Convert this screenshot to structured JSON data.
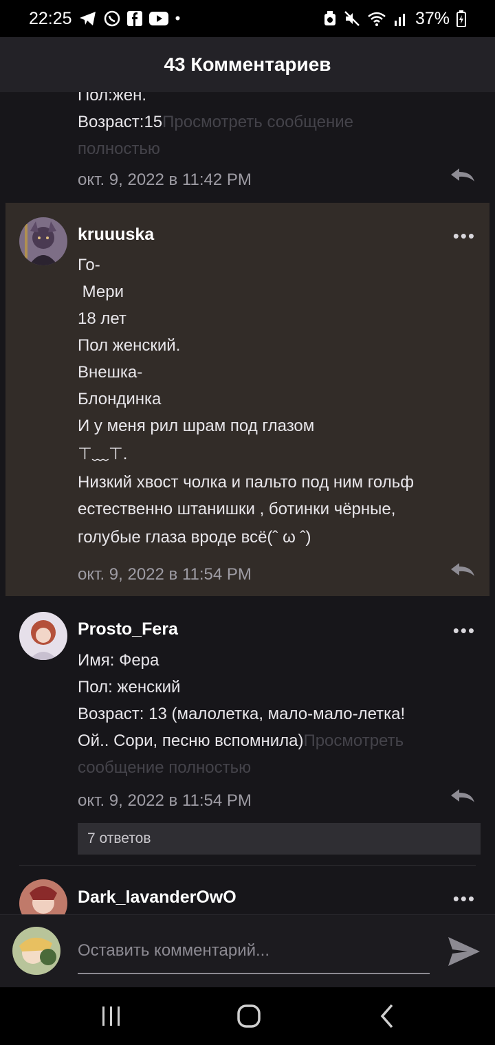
{
  "status": {
    "time": "22:25",
    "battery": "37%",
    "left_icons": [
      "telegram-icon",
      "whatsapp-icon",
      "facebook-icon",
      "youtube-icon",
      "dot-icon"
    ],
    "right_icons": [
      "recycle-icon",
      "mute-icon",
      "wifi-icon",
      "signal-icon",
      "battery-icon"
    ]
  },
  "header": {
    "title": "43 Комментариев"
  },
  "comments": [
    {
      "partial": true,
      "lines": [
        "Пол:жен.",
        "Возраст:15"
      ],
      "more": "Просмотреть сообщение полностью",
      "time": "окт. 9, 2022 в 11:42 PM"
    },
    {
      "user": "kruuuska",
      "highlighted": true,
      "lines": [
        "Го-",
        " Мери",
        "18 лет",
        "Пол женский.",
        "Внешка-",
        "Блондинка",
        "И у меня рил шрам под глазом",
        "⊤﹏⊤.",
        "Низкий хвост чолка и пальто под ним гольф",
        "естественно штанишки , ботинки чёрные,",
        "голубые глаза вроде всё(ˆ ω ˆ)"
      ],
      "time": "окт. 9, 2022 в 11:54 PM"
    },
    {
      "user": "Prosto_Fera",
      "lines": [
        "Имя: Фера",
        "Пол: женский",
        "Возраст: 13 (малолетка, мало-мало-летка!",
        "Ой.. Сори, песню вспомнила)"
      ],
      "more_inline": "Просмотреть",
      "more_line2": "сообщение полностью",
      "time": "окт. 9, 2022 в 11:54 PM",
      "replies": "7 ответов"
    },
    {
      "user": "Dark_lavanderOwO"
    }
  ],
  "composer": {
    "placeholder": "Оставить комментарий..."
  },
  "more_menu": "•••",
  "colors": {
    "highlight": "#322c28",
    "background": "#17161a"
  }
}
